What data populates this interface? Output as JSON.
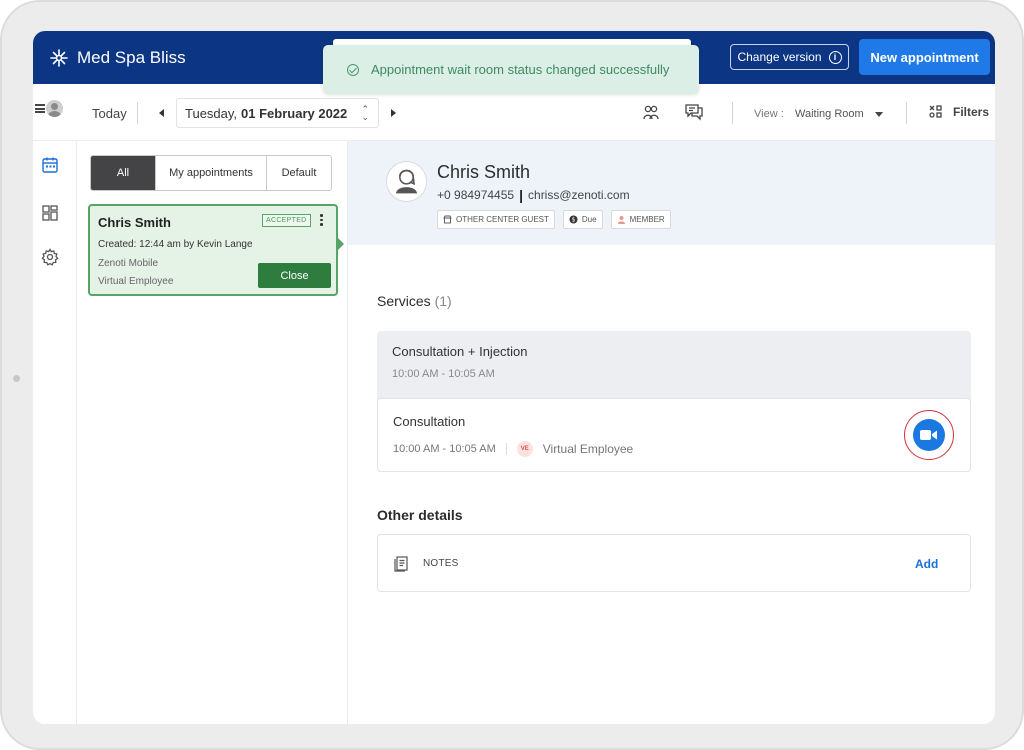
{
  "app": {
    "brand_name": "Med Spa Bliss",
    "change_version_label": "Change version",
    "new_appointment_label": "New appointment"
  },
  "toast": {
    "message": "Appointment wait room status changed successfully"
  },
  "toolbar": {
    "today_label": "Today",
    "date_prefix": "Tuesday,",
    "date_value": "01 February 2022",
    "view_label": "View :",
    "view_value": "Waiting Room",
    "filters_label": "Filters"
  },
  "list": {
    "tabs": [
      {
        "label": "All",
        "selected": true
      },
      {
        "label": "My appointments",
        "selected": false
      },
      {
        "label": "Default",
        "selected": false
      }
    ],
    "appointment": {
      "name": "Chris Smith",
      "status": "ACCEPTED",
      "created": "Created: 12:44 am by Kevin Lange",
      "source": "Zenoti Mobile",
      "employee": "Virtual Employee",
      "close_label": "Close"
    }
  },
  "guest": {
    "name": "Chris Smith",
    "phone": "+0 984974455",
    "email": "chriss@zenoti.com",
    "tags": [
      "OTHER CENTER GUEST",
      "Due",
      "MEMBER"
    ]
  },
  "services": {
    "title": "Services",
    "count": "(1)",
    "group": {
      "name": "Consultation + Injection",
      "time": "10:00 AM - 10:05 AM"
    },
    "item": {
      "name": "Consultation",
      "time": "10:00 AM - 10:05 AM",
      "employee_initials": "VE",
      "employee": "Virtual Employee"
    }
  },
  "other_details": {
    "title": "Other details",
    "notes_label": "NOTES",
    "add_label": "Add"
  },
  "colors": {
    "header_bg": "#0c3583",
    "primary_button": "#1f7ae8",
    "toast_bg": "#dcefe6",
    "card_accent": "#56a566",
    "video_button": "#1a78e0",
    "highlight_ring": "#d8323a"
  }
}
